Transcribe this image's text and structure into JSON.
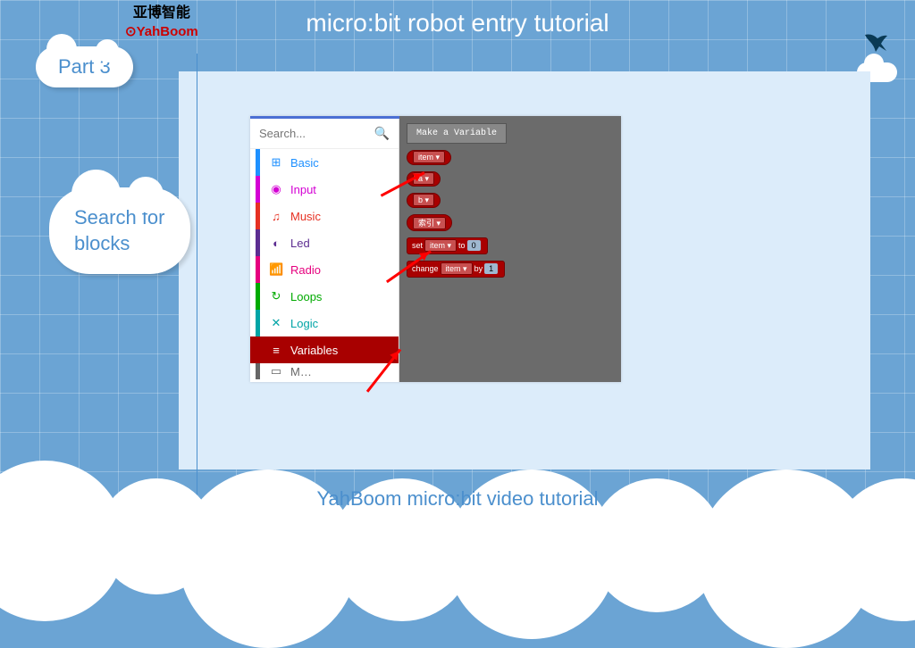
{
  "header": {
    "title": "micro:bit robot entry tutorial",
    "part": "Part 3"
  },
  "logo": {
    "cn": "亚博智能",
    "en": "YahBoom"
  },
  "label": {
    "line1": "Search for",
    "line2": "blocks"
  },
  "editor": {
    "search_placeholder": "Search...",
    "categories": [
      {
        "key": "basic",
        "label": "Basic",
        "glyph": "⊞"
      },
      {
        "key": "input",
        "label": "Input",
        "glyph": "◉"
      },
      {
        "key": "music",
        "label": "Music",
        "glyph": "♫"
      },
      {
        "key": "led",
        "label": "Led",
        "glyph": "◐"
      },
      {
        "key": "radio",
        "label": "Radio",
        "glyph": "📶"
      },
      {
        "key": "loops",
        "label": "Loops",
        "glyph": "↻"
      },
      {
        "key": "logic",
        "label": "Logic",
        "glyph": "✕"
      },
      {
        "key": "variables",
        "label": "Variables",
        "glyph": "≡"
      },
      {
        "key": "more",
        "label": "M…",
        "glyph": "▭"
      }
    ]
  },
  "workspace": {
    "make_variable": "Make a Variable",
    "var_blocks": [
      "item ▾",
      "a ▾",
      "b ▾",
      "索引 ▾"
    ],
    "set": {
      "prefix": "set",
      "var": "item ▾",
      "mid": "to",
      "val": "0"
    },
    "change": {
      "prefix": "change",
      "var": "item ▾",
      "mid": "by",
      "val": "1"
    }
  },
  "footer": {
    "text": "YahBoom      micro:bit video tutorial"
  }
}
